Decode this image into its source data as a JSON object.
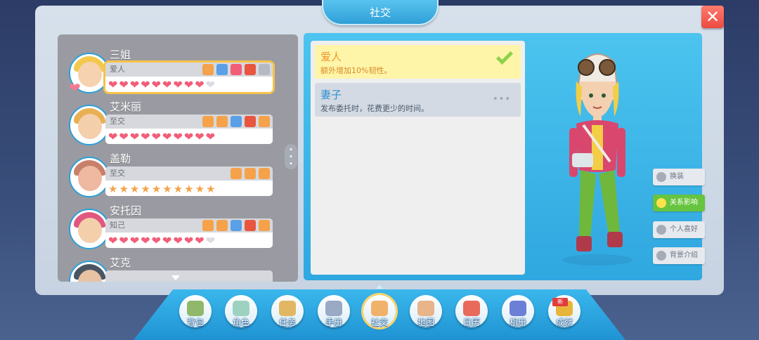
{
  "window": {
    "title": "社交",
    "close": "✕"
  },
  "friends": [
    {
      "name": "三姐",
      "relation": "爱人",
      "hearts": 9,
      "max": 10,
      "kind": "heart",
      "icons": [
        "#f5a24a",
        "#5aa0e6",
        "#f25e78",
        "#e8563f",
        "#b4b9c2"
      ],
      "hair": "#f2c94c",
      "skin": "#f6d2b0",
      "selected": true
    },
    {
      "name": "艾米丽",
      "relation": "至交",
      "hearts": 10,
      "max": 10,
      "kind": "heart",
      "icons": [
        "#f5a24a",
        "#f5a24a",
        "#5aa0e6",
        "#e8563f",
        "#f5a24a"
      ],
      "hair": "#e8b052",
      "skin": "#f3cfac",
      "selected": false
    },
    {
      "name": "盖勒",
      "relation": "至交",
      "hearts": 10,
      "max": 10,
      "kind": "star",
      "icons": [
        "#f5a24a",
        "#f5a24a",
        "#f5a24a"
      ],
      "hair": "#c9806a",
      "skin": "#efb8a0",
      "selected": false
    },
    {
      "name": "安托因",
      "relation": "知己",
      "hearts": 9,
      "max": 10,
      "kind": "heart",
      "icons": [
        "#f5a24a",
        "#f5a24a",
        "#5aa0e6",
        "#e8563f",
        "#f5a24a"
      ],
      "hair": "#e0587f",
      "skin": "#f3cfac",
      "selected": false
    },
    {
      "name": "艾克",
      "relation": "",
      "hearts": 0,
      "max": 0,
      "kind": "heart",
      "icons": [],
      "hair": "#4a5563",
      "skin": "#e7c3a4",
      "selected": false
    }
  ],
  "effects": [
    {
      "title": "爱人",
      "desc": "额外增加10%韧性。",
      "active": true
    },
    {
      "title": "妻子",
      "desc": "发布委托时，花费更少的时间。",
      "active": false
    }
  ],
  "side_buttons": [
    {
      "label": "换装",
      "icon": "outfit-icon",
      "on": false
    },
    {
      "label": "关系影响",
      "icon": "relationship-icon",
      "on": true
    },
    {
      "label": "个人喜好",
      "icon": "heart-icon",
      "on": false
    },
    {
      "label": "背景介绍",
      "icon": "person-icon",
      "on": false
    }
  ],
  "nav": [
    {
      "label": "背包",
      "icon": "backpack-icon",
      "color": "#8fb86a"
    },
    {
      "label": "角色",
      "icon": "character-icon",
      "color": "#9ed2c0"
    },
    {
      "label": "任务",
      "icon": "task-icon",
      "color": "#e2b763"
    },
    {
      "label": "手册",
      "icon": "hammer-icon",
      "color": "#9aa9c4"
    },
    {
      "label": "社交",
      "icon": "handshake-icon",
      "color": "#f0b26a",
      "current": true
    },
    {
      "label": "地图",
      "icon": "map-icon",
      "color": "#e8b48a"
    },
    {
      "label": "日历",
      "icon": "calendar-icon",
      "color": "#e86a5a"
    },
    {
      "label": "相册",
      "icon": "album-icon",
      "color": "#6b7fd6"
    },
    {
      "label": "成就",
      "icon": "trophy-icon",
      "color": "#e8b53a"
    }
  ],
  "badges": {
    "new": "新"
  }
}
